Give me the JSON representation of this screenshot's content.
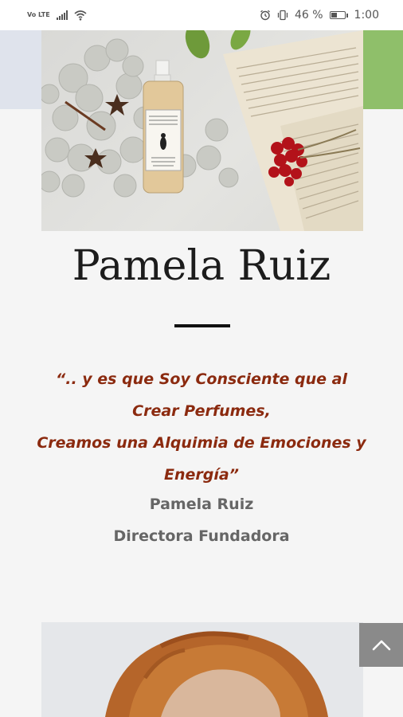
{
  "status_bar": {
    "network": "Vo LTE",
    "battery_percent": "46 %",
    "battery_level": 0.46,
    "time": "1:00",
    "icons": [
      "signal-icon",
      "wifi-icon",
      "alarm-icon",
      "vibrate-icon",
      "battery-icon"
    ]
  },
  "hero_image": {
    "label_text": "",
    "description_icon": "perfume-bottle-image"
  },
  "profile": {
    "name": "Pamela Ruiz",
    "quote_lines": [
      "“.. y es que Soy Consciente que al Crear Perfumes,",
      "Creamos una Alquimia de Emociones y Energía”"
    ],
    "author": "Pamela Ruiz",
    "role": "Directora Fundadora"
  },
  "colors": {
    "quote": "#8b2a0f",
    "background": "#f5f5f5",
    "accent_green": "#8fbf6a",
    "scroll_button": "#8a8a8a"
  },
  "scroll_top_button": {
    "icon": "chevron-up-icon"
  }
}
